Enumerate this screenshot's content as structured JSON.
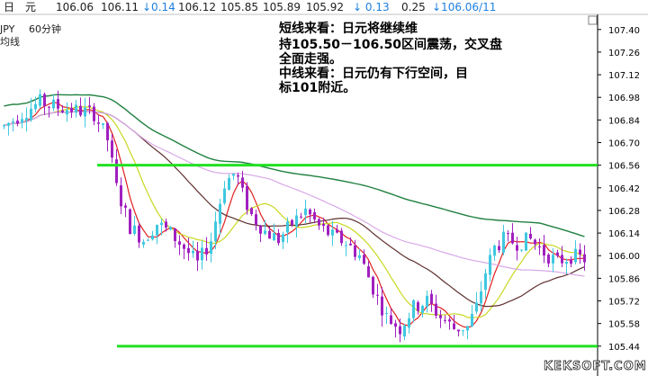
{
  "header": {
    "period_char": "日",
    "currency_char": "元",
    "open": "106.06",
    "high": "106.11",
    "change_down_arrow": "↓0.14",
    "low_label": "106.12",
    "close": "105.85",
    "val5": "105.89",
    "val6": "105.92",
    "change2": "↓ 0.13",
    "change3": "0.25",
    "date": "↓106.06/11"
  },
  "legend": {
    "symbol": "JPY",
    "timeframe": "60分钟",
    "ma_label": "均线"
  },
  "annotation": {
    "lines": [
      "短线来看：日元将继续维",
      "持105.50－106.50区间震荡，交叉盘",
      "全面走强。",
      "中线来看：日元仍有下行空间，目",
      "标101附近。"
    ]
  },
  "watermark": "KEKSOFT.COM",
  "colors": {
    "bg": "#ffffff",
    "bull": "#40c8e0",
    "bear": "#a020c0",
    "support": "#22e022",
    "ma_red": "#e02020",
    "ma_yellow": "#c8d820",
    "ma_brown": "#603030",
    "ma_violet": "#d8a8e8",
    "ma_green": "#208040",
    "header_text": "#202020",
    "down_text": "#2080e0"
  },
  "chart_data": {
    "type": "candlestick",
    "y_ticks": [
      "107.40",
      "107.26",
      "107.12",
      "106.98",
      "106.84",
      "106.70",
      "106.56",
      "106.42",
      "106.28",
      "106.14",
      "106.00",
      "105.86",
      "105.72",
      "105.58",
      "105.44"
    ],
    "ylim": [
      105.4,
      107.46
    ],
    "horizontal_levels": [
      106.56,
      105.44
    ],
    "candle_count": 130
  }
}
